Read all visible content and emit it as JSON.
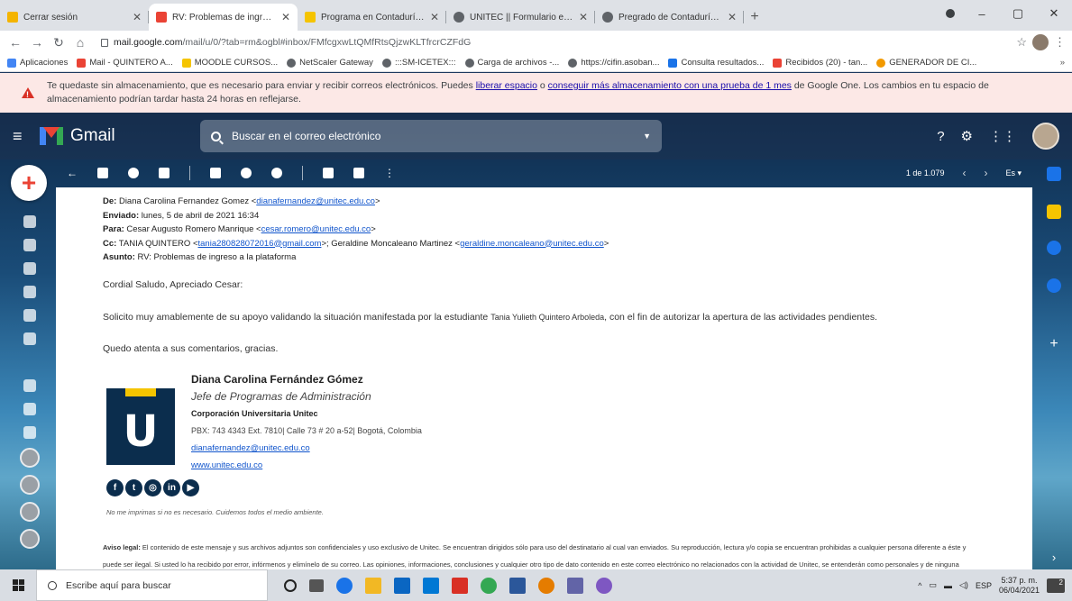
{
  "browser": {
    "tabs": [
      {
        "title": "Cerrar sesión",
        "favicon_color": "#f4b400"
      },
      {
        "title": "RV: Problemas de ingreso a la pl",
        "favicon_color": "#ea4335",
        "active": true
      },
      {
        "title": "Programa en Contaduría Pública",
        "favicon_color": "#f5c400"
      },
      {
        "title": "UNITEC || Formulario en línea",
        "favicon_color": "#5f6368"
      },
      {
        "title": "Pregrado de Contaduría Pública",
        "favicon_color": "#5f6368"
      }
    ],
    "new_tab": "+",
    "window_controls": {
      "minimize": "–",
      "maximize": "▢",
      "close": "✕"
    },
    "address": {
      "host": "mail.google.com",
      "path": "/mail/u/0/?tab=rm&ogbl#inbox/FMfcgxwLtQMfRtsQjzwKLTfrcrCZFdG"
    },
    "bookmarks": [
      {
        "label": "Aplicaciones",
        "color": "#4285f4"
      },
      {
        "label": "Mail - QUINTERO A...",
        "color": "#ea4335"
      },
      {
        "label": "MOODLE CURSOS...",
        "color": "#f5c400"
      },
      {
        "label": "NetScaler Gateway",
        "color": "#5f6368"
      },
      {
        "label": ":::SM-ICETEX:::",
        "color": "#5f6368"
      },
      {
        "label": "Carga de archivos -...",
        "color": "#5f6368"
      },
      {
        "label": "https://cifin.asoban...",
        "color": "#5f6368"
      },
      {
        "label": "Consulta resultados...",
        "color": "#1a73e8"
      },
      {
        "label": "Recibidos (20) - tan...",
        "color": "#ea4335"
      },
      {
        "label": "GENERADOR DE CI...",
        "color": "#f29900"
      }
    ],
    "bookmarks_more": "»"
  },
  "banner": {
    "text_a": "Te quedaste sin almacenamiento, que es necesario para enviar y recibir correos electrónicos. Puedes ",
    "link1": "liberar espacio",
    "text_b": " o ",
    "link2": "conseguir más almacenamiento con una prueba de 1 mes",
    "text_c": " de Google One. Los cambios en tu espacio de",
    "text_d": "almacenamiento podrían tardar hasta 24 horas en reflejarse."
  },
  "gmail": {
    "product": "Gmail",
    "search_placeholder": "Buscar en el correo electrónico",
    "pager": "1 de 1.079",
    "lang": "Es"
  },
  "email": {
    "from_label": "De:",
    "from_name": "Diana Carolina Fernandez Gomez <",
    "from_email": "dianafernandez@unitec.edu.co",
    "sent_label": "Enviado:",
    "sent_value": "lunes, 5 de abril de 2021 16:34",
    "to_label": "Para:",
    "to_name": "Cesar Augusto Romero Manrique <",
    "to_email": "cesar.romero@unitec.edu.co",
    "cc_label": "Cc:",
    "cc_name1": "TANIA QUINTERO <",
    "cc_email1": "tania280828072016@gmail.com",
    "cc_mid": ">; Geraldine Moncaleano Martinez <",
    "cc_email2": "geraldine.moncaleano@unitec.edu.co",
    "subject_label": "Asunto:",
    "subject_value": "RV: Problemas de ingreso a la plataforma",
    "greeting": "Cordial Saludo, Apreciado Cesar:",
    "body_a": "Solicito muy amablemente de su apoyo validando la situación manifestada por la estudiante ",
    "body_student": "Tania Yulieth Quintero Arboleda",
    "body_b": ", con el fin de autorizar la apertura de las actividades pendientes.",
    "closing": "Quedo atenta a sus comentarios, gracias."
  },
  "signature": {
    "name": "Diana Carolina Fernández Gómez",
    "role": "Jefe de Programas de Administración",
    "org": "Corporación Universitaria Unitec",
    "address": "PBX: 743 4343 Ext. 7810| Calle 73 # 20 a-52| Bogotá, Colombia",
    "email": "dianafernandez@unitec.edu.co",
    "web": "www.unitec.edu.co",
    "logo_letter": "U",
    "social": [
      "f",
      "t",
      "◎",
      "in",
      "▶"
    ],
    "eco_note": "No me imprimas si no es necesario. Cuidemos todos el medio ambiente."
  },
  "legal": {
    "label": "Aviso legal:",
    "line1": " El contenido de este mensaje y sus archivos adjuntos son confidenciales y uso exclusivo de Unitec. Se encuentran dirigidos sólo para uso del destinatario al cual van enviados. Su reproducción, lectura y/o copia se encuentran prohibidas a cualquier persona diferente a éste y",
    "line2": "puede ser ilegal. Si usted lo ha recibido por error, infórmenos y elimínelo de su correo. Las opiniones, informaciones, conclusiones y cualquier otro tipo de dato contenido en este correo electrónico no relacionados con la actividad de Unitec, se entenderán como personales y de ninguna"
  },
  "taskbar": {
    "search_placeholder": "Escribe aquí para buscar",
    "lang": "ESP",
    "time": "5:37 p. m.",
    "date": "06/04/2021",
    "notifications": "2"
  }
}
